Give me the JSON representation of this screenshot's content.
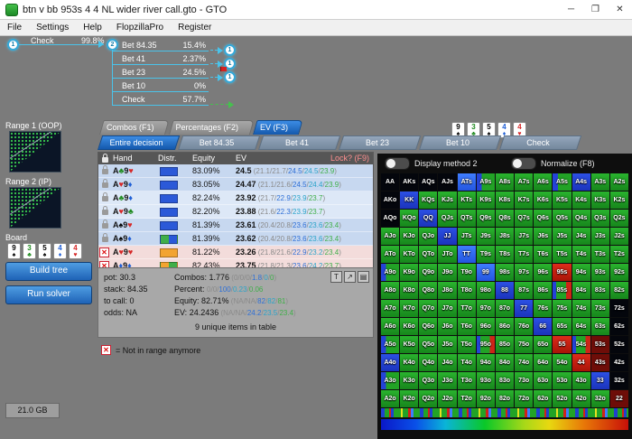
{
  "window": {
    "title": "btn v bb 953s 4 4 NL wider river call.gto - GTO",
    "controls": [
      "─",
      "❐",
      "✕"
    ]
  },
  "menu": {
    "items": [
      "File",
      "Settings",
      "Help",
      "FlopzillaPro",
      "Register"
    ]
  },
  "tree": {
    "node1": "1",
    "node2": "2",
    "root_action": {
      "label": "Check",
      "pct": "99.8%"
    },
    "actions": [
      {
        "label": "Bet 84.35",
        "pct": "15.4%",
        "target": "1",
        "arrow": "cyan",
        "flag": false
      },
      {
        "label": "Bet 41",
        "pct": "2.37%",
        "target": "1",
        "arrow": "cyan",
        "flag": false
      },
      {
        "label": "Bet 23",
        "pct": "24.5%",
        "target": "1",
        "arrow": "cyan",
        "flag": true
      },
      {
        "label": "Bet 10",
        "pct": "0%",
        "target": "",
        "arrow": "none",
        "flag": false
      },
      {
        "label": "Check",
        "pct": "57.7%",
        "target": "",
        "arrow": "green",
        "flag": false
      }
    ]
  },
  "sidebar": {
    "range1_label": "Range 1 (OOP)",
    "range2_label": "Range 2 (IP)",
    "board_label": "Board",
    "board_cards": [
      {
        "r": "9",
        "s": "♠"
      },
      {
        "r": "3",
        "s": "♣"
      },
      {
        "r": "5",
        "s": "♠"
      },
      {
        "r": "4",
        "s": "♦"
      },
      {
        "r": "4",
        "s": "♥"
      }
    ],
    "build_tree": "Build tree",
    "run_solver": "Run solver",
    "memory": "21.0 GB"
  },
  "tabs": {
    "main": [
      {
        "label": "Combos (F1)",
        "active": false
      },
      {
        "label": "Percentages (F2)",
        "active": false
      },
      {
        "label": "EV (F3)",
        "active": true
      }
    ],
    "board_badges": [
      {
        "r": "9",
        "s": "♠"
      },
      {
        "r": "3",
        "s": "♣"
      },
      {
        "r": "5",
        "s": "♠"
      },
      {
        "r": "4",
        "s": "♦"
      },
      {
        "r": "4",
        "s": "♥"
      }
    ],
    "sub": [
      {
        "label": "Entire decision",
        "active": true
      },
      {
        "label": "Bet 84.35",
        "active": false
      },
      {
        "label": "Bet 41",
        "active": false
      },
      {
        "label": "Bet 23",
        "active": false
      },
      {
        "label": "Bet 10",
        "active": false
      },
      {
        "label": "Check",
        "active": false
      }
    ]
  },
  "table": {
    "headers": {
      "hand": "Hand",
      "distr": "Distr.",
      "equity": "Equity",
      "ev": "EV"
    },
    "lock_header": "Lock? (F9)",
    "rows": [
      {
        "x": false,
        "hand": "A♣9♥",
        "distr": [
          "#2b59d8"
        ],
        "equity": "83.09%",
        "ev": "24.5",
        "parts": [
          "21.1",
          "21.7",
          "24.5",
          "24.5",
          "23.9"
        ],
        "bg": "b1"
      },
      {
        "x": false,
        "hand": "A♥9♦",
        "distr": [
          "#2b59d8"
        ],
        "equity": "83.05%",
        "ev": "24.47",
        "parts": [
          "21.1",
          "21.6",
          "24.5",
          "24.4",
          "23.9"
        ],
        "bg": "b1"
      },
      {
        "x": false,
        "hand": "A♣9♦",
        "distr": [
          "#2b59d8"
        ],
        "equity": "82.24%",
        "ev": "23.92",
        "parts": [
          "21.7",
          "22.9",
          "23.9",
          "23.7"
        ],
        "bg": "b2"
      },
      {
        "x": false,
        "hand": "A♥9♣",
        "distr": [
          "#2b59d8"
        ],
        "equity": "82.20%",
        "ev": "23.88",
        "parts": [
          "21.6",
          "22.3",
          "23.9",
          "23.7"
        ],
        "bg": "b2"
      },
      {
        "x": false,
        "hand": "A♠9♥",
        "distr": [
          "#2b59d8"
        ],
        "equity": "81.39%",
        "ev": "23.61",
        "parts": [
          "20.4",
          "20.8",
          "23.6",
          "23.6",
          "23.4"
        ],
        "bg": "b1"
      },
      {
        "x": false,
        "hand": "A♠9♦",
        "distr": [
          "#3fae49",
          "#2b59d8"
        ],
        "equity": "81.39%",
        "ev": "23.62",
        "parts": [
          "20.4",
          "20.8",
          "23.6",
          "23.6",
          "23.4"
        ],
        "bg": "b1"
      },
      {
        "x": true,
        "hand": "A♥9♥",
        "distr": [
          "#f2a431"
        ],
        "equity": "81.22%",
        "ev": "23.26",
        "parts": [
          "21.8",
          "21.6",
          "22.9",
          "23.2",
          "23.4"
        ],
        "bg": "pink"
      },
      {
        "x": true,
        "hand": "A♦9♦",
        "distr": [
          "#f2a431",
          "#3fae49"
        ],
        "equity": "82.43%",
        "ev": "23.75",
        "parts": [
          "21.8",
          "21.3",
          "23.6",
          "24.2",
          "23.7"
        ],
        "bg": "pink"
      }
    ]
  },
  "info": {
    "left_rows": [
      {
        "label": "pot:",
        "value": "30.3"
      },
      {
        "label": "stack:",
        "value": "84.35"
      },
      {
        "label": "to call:",
        "value": "0"
      },
      {
        "label": "odds:",
        "value": "NA"
      }
    ],
    "right_rows": [
      {
        "label": "Combos:",
        "value": "1.776",
        "parts": [
          "0",
          "0",
          "0",
          "1.8",
          "0",
          "0"
        ],
        "parens": true
      },
      {
        "label": "Percent:",
        "value": "",
        "parts": [
          "0",
          "0",
          "100",
          "0.23",
          "0.06"
        ],
        "parens": false
      },
      {
        "label": "Equity:",
        "value": "82.71%",
        "parts": [
          "NA",
          "NA",
          "82",
          "82",
          "81"
        ],
        "parens": true
      },
      {
        "label": "EV:",
        "value": "24.2436",
        "parts": [
          "NA",
          "NA",
          "24.2",
          "23.5",
          "23.4"
        ],
        "parens": true
      }
    ],
    "icons": [
      "T",
      "↗",
      "▤"
    ],
    "items": "9 unique items in table"
  },
  "legend": {
    "x_icon": "✕",
    "x_note": "= Not in range anymore"
  },
  "panel": {
    "toggle1": "Display method 2",
    "toggle2": "Normalize (F8)"
  },
  "matrix": {
    "labels": [
      [
        "AA",
        "AKs",
        "AQs",
        "AJs",
        "ATs",
        "A9s",
        "A8s",
        "A7s",
        "A6s",
        "A5s",
        "A4s",
        "A3s",
        "A2s"
      ],
      [
        "AKo",
        "KK",
        "KQs",
        "KJs",
        "KTs",
        "K9s",
        "K8s",
        "K7s",
        "K6s",
        "K5s",
        "K4s",
        "K3s",
        "K2s"
      ],
      [
        "AQo",
        "KQo",
        "QQ",
        "QJs",
        "QTs",
        "Q9s",
        "Q8s",
        "Q7s",
        "Q6s",
        "Q5s",
        "Q4s",
        "Q3s",
        "Q2s"
      ],
      [
        "AJo",
        "KJo",
        "QJo",
        "JJ",
        "JTs",
        "J9s",
        "J8s",
        "J7s",
        "J6s",
        "J5s",
        "J4s",
        "J3s",
        "J2s"
      ],
      [
        "ATo",
        "KTo",
        "QTo",
        "JTo",
        "TT",
        "T9s",
        "T8s",
        "T7s",
        "T6s",
        "T5s",
        "T4s",
        "T3s",
        "T2s"
      ],
      [
        "A9o",
        "K9o",
        "Q9o",
        "J9o",
        "T9o",
        "99",
        "98s",
        "97s",
        "96s",
        "95s",
        "94s",
        "93s",
        "92s"
      ],
      [
        "A8o",
        "K8o",
        "Q8o",
        "J8o",
        "T8o",
        "98o",
        "88",
        "87s",
        "86s",
        "85s",
        "84s",
        "83s",
        "82s"
      ],
      [
        "A7o",
        "K7o",
        "Q7o",
        "J7o",
        "T7o",
        "97o",
        "87o",
        "77",
        "76s",
        "75s",
        "74s",
        "73s",
        "72s"
      ],
      [
        "A6o",
        "K6o",
        "Q6o",
        "J6o",
        "T6o",
        "96o",
        "86o",
        "76o",
        "66",
        "65s",
        "64s",
        "63s",
        "62s"
      ],
      [
        "A5o",
        "K5o",
        "Q5o",
        "J5o",
        "T5o",
        "95o",
        "85o",
        "75o",
        "65o",
        "55",
        "54s",
        "53s",
        "52s"
      ],
      [
        "A4o",
        "K4o",
        "Q4o",
        "J4o",
        "T4o",
        "94o",
        "84o",
        "74o",
        "64o",
        "54o",
        "44",
        "43s",
        "42s"
      ],
      [
        "A3o",
        "K3o",
        "Q3o",
        "J3o",
        "T3o",
        "93o",
        "83o",
        "73o",
        "63o",
        "53o",
        "43o",
        "33",
        "32s"
      ],
      [
        "A2o",
        "K2o",
        "Q2o",
        "J2o",
        "T2o",
        "92o",
        "82o",
        "72o",
        "62o",
        "52o",
        "42o",
        "32o",
        "22"
      ]
    ],
    "colors": [
      [
        "k",
        "k",
        "k",
        "k",
        "B",
        "gb",
        "g",
        "g",
        "g",
        "gb",
        "b",
        "g",
        "g"
      ],
      [
        "k",
        "b",
        "g",
        "g",
        "g",
        "g",
        "g",
        "g",
        "g",
        "g",
        "g",
        "g",
        "g"
      ],
      [
        "k",
        "g",
        "b",
        "g",
        "g",
        "g",
        "g",
        "g",
        "g",
        "g",
        "g",
        "g",
        "g"
      ],
      [
        "g",
        "g",
        "g",
        "b",
        "g",
        "g",
        "g",
        "g",
        "g",
        "g",
        "g",
        "g",
        "g"
      ],
      [
        "g",
        "g",
        "g",
        "g",
        "B",
        "g",
        "g",
        "g",
        "g",
        "g",
        "g",
        "g",
        "g"
      ],
      [
        "gb",
        "g",
        "g",
        "g",
        "g",
        "B",
        "g",
        "g",
        "g",
        "r",
        "g",
        "g",
        "g"
      ],
      [
        "g",
        "g",
        "g",
        "g",
        "g",
        "g",
        "b",
        "g",
        "g",
        "m",
        "g",
        "g",
        "g"
      ],
      [
        "g",
        "g",
        "g",
        "g",
        "g",
        "g",
        "g",
        "b",
        "g",
        "g",
        "g",
        "g",
        "k"
      ],
      [
        "g",
        "g",
        "g",
        "g",
        "g",
        "g",
        "g",
        "g",
        "b",
        "g",
        "g",
        "g",
        "k"
      ],
      [
        "gb",
        "g",
        "g",
        "g",
        "g",
        "m",
        "g",
        "g",
        "g",
        "r",
        "m",
        "dr",
        "k"
      ],
      [
        "b",
        "g",
        "g",
        "g",
        "g",
        "g",
        "g",
        "g",
        "g",
        "g",
        "r",
        "dr",
        "k"
      ],
      [
        "gb",
        "g",
        "g",
        "g",
        "g",
        "g",
        "g",
        "g",
        "g",
        "g",
        "g",
        "b",
        "k"
      ],
      [
        "g",
        "g",
        "g",
        "g",
        "g",
        "g",
        "g",
        "g",
        "g",
        "g",
        "g",
        "g",
        "dr"
      ]
    ]
  },
  "colors": {
    "suits": {
      "♠": "#000000",
      "♥": "#d62828",
      "♦": "#1f5fd6",
      "♣": "#1d8a1d"
    },
    "parts": {
      "grey": "#8a8a8a",
      "blue": "#2e6fd6",
      "teal": "#2aa3c9",
      "green": "#3fae49"
    }
  }
}
